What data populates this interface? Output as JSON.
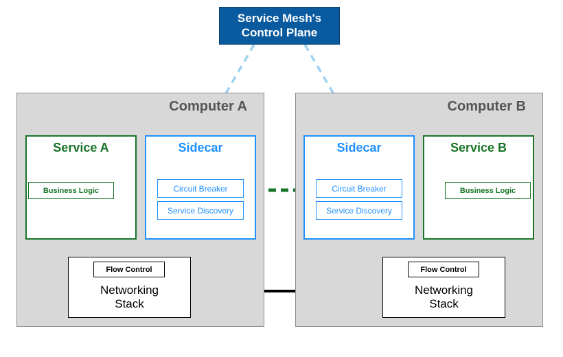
{
  "control_plane": {
    "line1": "Service Mesh's",
    "line2": "Control Plane"
  },
  "computers": {
    "a": {
      "label": "Computer A",
      "service": {
        "name": "Service A",
        "biz": "Business Logic"
      },
      "sidecar": {
        "name": "Sidecar",
        "cb": "Circuit Breaker",
        "sd": "Service Discovery"
      },
      "net": {
        "name": "Networking\nStack",
        "flow": "Flow Control"
      }
    },
    "b": {
      "label": "Computer B",
      "service": {
        "name": "Service B",
        "biz": "Business Logic"
      },
      "sidecar": {
        "name": "Sidecar",
        "cb": "Circuit Breaker",
        "sd": "Service Discovery"
      },
      "net": {
        "name": "Networking\nStack",
        "flow": "Flow Control"
      }
    }
  },
  "colors": {
    "control_plane_bg": "#0a5aa0",
    "sidecar": "#1e90ff",
    "service": "#197528",
    "cp_link": "#9fd1f0",
    "midline": "#197528"
  }
}
